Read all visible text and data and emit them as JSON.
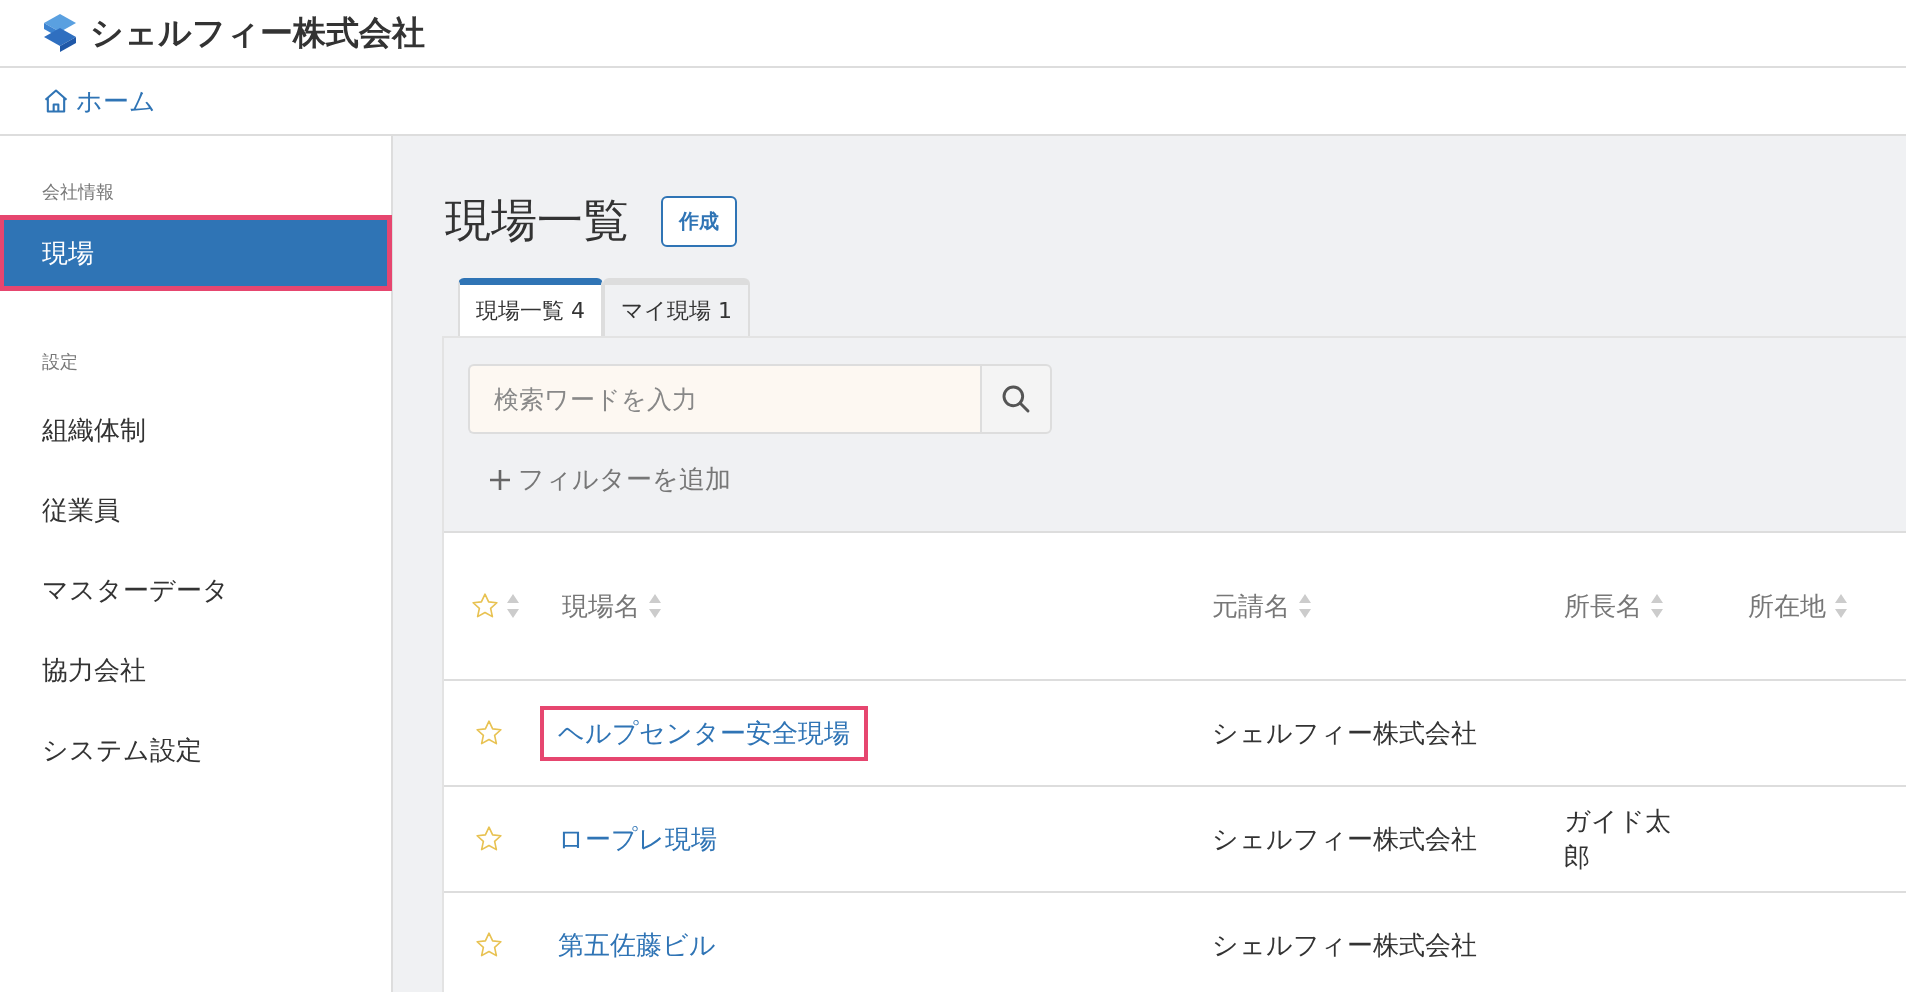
{
  "header": {
    "company": "シェルフィー株式会社"
  },
  "breadcrumb": [
    {
      "label": "ホーム"
    }
  ],
  "sidebar": {
    "sections": [
      {
        "title": "会社情報",
        "items": [
          {
            "label": "現場",
            "selected": true,
            "highlighted": true
          }
        ]
      },
      {
        "title": "設定",
        "items": [
          {
            "label": "組織体制",
            "selected": false,
            "highlighted": false
          },
          {
            "label": "従業員",
            "selected": false,
            "highlighted": false
          },
          {
            "label": "マスターデータ",
            "selected": false,
            "highlighted": false
          },
          {
            "label": "協力会社",
            "selected": false,
            "highlighted": false
          },
          {
            "label": "システム設定",
            "selected": false,
            "highlighted": false
          }
        ]
      }
    ]
  },
  "page": {
    "title": "現場一覧",
    "create_button": "作成"
  },
  "tabs": [
    {
      "label": "現場一覧",
      "count": "4",
      "selected": true
    },
    {
      "label": "マイ現場",
      "count": "1",
      "selected": false
    }
  ],
  "search": {
    "placeholder": "検索ワードを入力"
  },
  "filter_button": "フィルターを追加",
  "table": {
    "columns": [
      {
        "label": "現場名"
      },
      {
        "label": "元請名"
      },
      {
        "label": "所長名"
      },
      {
        "label": "所在地"
      }
    ],
    "rows": [
      {
        "starred": false,
        "name": "ヘルプセンター安全現場",
        "highlighted": true,
        "contractor": "シェルフィー株式会社"
      },
      {
        "starred": false,
        "name": "ロープレ現場",
        "highlighted": false,
        "contractor": "シェルフィー株式会社",
        "manager": "ガイド太郎"
      },
      {
        "starred": false,
        "name": "第五佐藤ビル",
        "highlighted": false,
        "contractor": "シェルフィー株式会社"
      }
    ]
  }
}
